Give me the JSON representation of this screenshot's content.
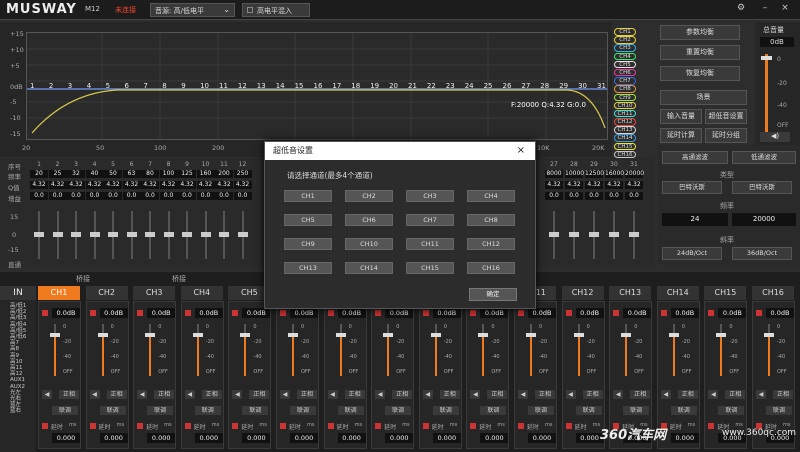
{
  "topbar": {
    "logo": "MUSWAY",
    "model": "M12",
    "status": "未连接",
    "source": "音源: 高/低电平",
    "hl_mix": "高电平混入",
    "status_color": "#f04a2a"
  },
  "eq": {
    "yticks": [
      "+15",
      "+10",
      "+5",
      "0dB",
      "-5",
      "-10",
      "-15"
    ],
    "xticks": [
      "20",
      "50",
      "100",
      "200",
      "500",
      "1K",
      "2K",
      "5K",
      "10K",
      "20K"
    ],
    "readout": "F:20000 Q:4.32 G:0.0",
    "points": [
      "1",
      "2",
      "3",
      "4",
      "5",
      "6",
      "7",
      "8",
      "9",
      "10",
      "11",
      "12",
      "13",
      "14",
      "15",
      "16",
      "17",
      "18",
      "19",
      "20",
      "21",
      "22",
      "23",
      "24",
      "25",
      "26",
      "27",
      "28",
      "29",
      "30",
      "31"
    ]
  },
  "ch_tags": [
    "CH1",
    "CH2",
    "CH3",
    "CH4",
    "CH5",
    "CH6",
    "CH7",
    "CH8",
    "CH9",
    "CH10",
    "CH11",
    "CH12",
    "CH13",
    "CH14",
    "CH15",
    "CH16"
  ],
  "ch_tag_colors": [
    "#e8d23a",
    "#e8d23a",
    "#3ab0e8",
    "#3ae86a",
    "#e8e8e8",
    "#e83a9a",
    "#3a6ae8",
    "#e8963a",
    "#9ae83a",
    "#e8d23a",
    "#3ae8d8",
    "#e84a3a",
    "#d8d8d8",
    "#3a9ae8",
    "#e8e83a",
    "#c8c8c8"
  ],
  "right_buttons": {
    "param_eq": "参数均衡",
    "reset_eq": "重置均衡",
    "restore_eq": "恢复均衡",
    "scene": "场景",
    "input_vol": "输入音量",
    "sub_setting": "超低音设置",
    "delay_calc": "延时计算",
    "delay_group": "延时分组"
  },
  "volume": {
    "title": "总音量",
    "value": "0dB",
    "ticks": [
      "0",
      "-20",
      "-40",
      "OFF"
    ]
  },
  "params": {
    "row_labels": [
      "序号",
      "频率",
      "Q值",
      "增益"
    ],
    "idx": [
      "1",
      "2",
      "3",
      "4",
      "5",
      "6",
      "7",
      "8",
      "9",
      "10",
      "11",
      "12"
    ],
    "freq": [
      "20",
      "25",
      "32",
      "40",
      "50",
      "63",
      "80",
      "100",
      "125",
      "160",
      "200",
      "250"
    ],
    "q": [
      "4.32",
      "4.32",
      "4.32",
      "4.32",
      "4.32",
      "4.32",
      "4.32",
      "4.32",
      "4.32",
      "4.32",
      "4.32",
      "4.32"
    ],
    "gain": [
      "0.0",
      "0.0",
      "0.0",
      "0.0",
      "0.0",
      "0.0",
      "0.0",
      "0.0",
      "0.0",
      "0.0",
      "0.0",
      "0.0"
    ],
    "right_idx": [
      "27",
      "28",
      "29",
      "30",
      "31"
    ],
    "right_freq": [
      "8000",
      "10000",
      "12500",
      "16000",
      "20000"
    ],
    "right_q": [
      "4.32",
      "4.32",
      "4.32",
      "4.32",
      "4.32"
    ],
    "right_gain": [
      "0.0",
      "0.0",
      "0.0",
      "0.0",
      "0.0"
    ],
    "slider_labels": [
      "15",
      "0",
      "-15",
      "直通"
    ]
  },
  "filters": {
    "hp": "高通滤波",
    "lp": "低通滤波",
    "type_label": "类型",
    "hp_type": "巴特沃斯",
    "lp_type": "巴特沃斯",
    "freq_label": "频率",
    "hp_freq": "24",
    "lp_freq": "20000",
    "slope_label": "斜率",
    "hp_slope": "24dB/Oct",
    "lp_slope": "36dB/Oct"
  },
  "bridge": "桥接",
  "input_panel": {
    "title": "IN",
    "rows": [
      "高/低1",
      "高/低2",
      "高/低3",
      "高/低4",
      "高/低5",
      "高/低6",
      "高7",
      "高8",
      "高9",
      "高10",
      "高11",
      "高12",
      "AUX1",
      "AUX2",
      "光左",
      "光右",
      "蓝左",
      "蓝右"
    ]
  },
  "channels": [
    "CH1",
    "CH2",
    "CH3",
    "CH4",
    "CH5",
    "CH6",
    "CH7",
    "CH8",
    "CH9",
    "CH10",
    "CH11",
    "CH12",
    "CH13",
    "CH14",
    "CH15",
    "CH16"
  ],
  "strip": {
    "db": "0.0dB",
    "ticks": [
      "0",
      "-20",
      "-40",
      "OFF"
    ],
    "phase": "正相",
    "link": "联调",
    "delay": "延时",
    "unit": "ms",
    "delay_val": "0.000"
  },
  "modal": {
    "title": "超低音设置",
    "close": "×",
    "prompt": "请选择通道(最多4个通道)",
    "channels": [
      "CH1",
      "CH2",
      "CH3",
      "CH4",
      "CH5",
      "CH6",
      "CH7",
      "CH8",
      "CH9",
      "CH10",
      "CH11",
      "CH12",
      "CH13",
      "CH14",
      "CH15",
      "CH16"
    ],
    "ok": "确定"
  },
  "watermark": {
    "a": "360汽车网",
    "b": "www.360qc.com"
  }
}
